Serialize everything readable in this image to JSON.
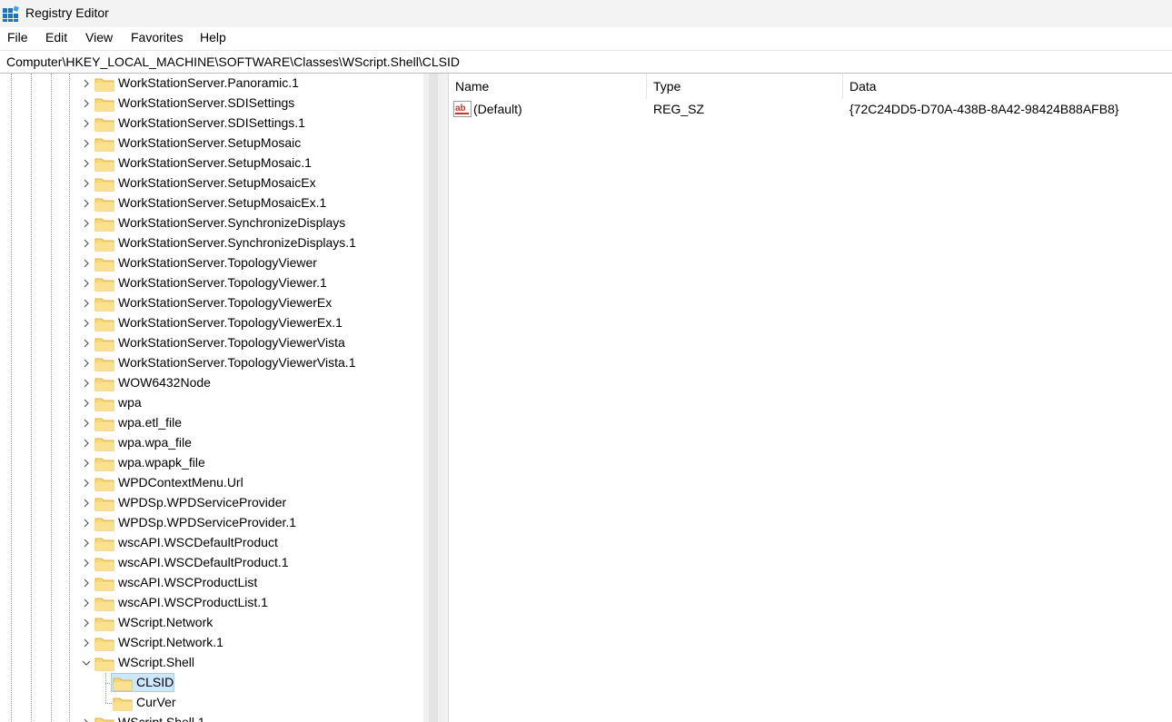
{
  "window": {
    "title": "Registry Editor"
  },
  "menu": [
    "File",
    "Edit",
    "View",
    "Favorites",
    "Help"
  ],
  "address": "Computer\\HKEY_LOCAL_MACHINE\\SOFTWARE\\Classes\\WScript.Shell\\CLSID",
  "tree": {
    "items": [
      "WorkStationServer.Panoramic.1",
      "WorkStationServer.SDISettings",
      "WorkStationServer.SDISettings.1",
      "WorkStationServer.SetupMosaic",
      "WorkStationServer.SetupMosaic.1",
      "WorkStationServer.SetupMosaicEx",
      "WorkStationServer.SetupMosaicEx.1",
      "WorkStationServer.SynchronizeDisplays",
      "WorkStationServer.SynchronizeDisplays.1",
      "WorkStationServer.TopologyViewer",
      "WorkStationServer.TopologyViewer.1",
      "WorkStationServer.TopologyViewerEx",
      "WorkStationServer.TopologyViewerEx.1",
      "WorkStationServer.TopologyViewerVista",
      "WorkStationServer.TopologyViewerVista.1",
      "WOW6432Node",
      "wpa",
      "wpa.etl_file",
      "wpa.wpa_file",
      "wpa.wpapk_file",
      "WPDContextMenu.Url",
      "WPDSp.WPDServiceProvider",
      "WPDSp.WPDServiceProvider.1",
      "wscAPI.WSCDefaultProduct",
      "wscAPI.WSCDefaultProduct.1",
      "wscAPI.WSCProductList",
      "wscAPI.WSCProductList.1",
      "WScript.Network",
      "WScript.Network.1",
      "WScript.Shell"
    ],
    "children": [
      "CLSID",
      "CurVer"
    ],
    "selected": "CLSID",
    "partial_item": "WScript.Shell.1"
  },
  "list": {
    "columns": [
      "Name",
      "Type",
      "Data"
    ],
    "rows": [
      {
        "name": "(Default)",
        "type": "REG_SZ",
        "data": "{72C24DD5-D70A-438B-8A42-98424B88AFB8}",
        "icon": "string-value-icon"
      }
    ]
  },
  "colors": {
    "folder": "#f8d775",
    "folder_edge": "#dcb04a",
    "selection": "#cce8ff",
    "selection_border": "#99d1ff"
  }
}
